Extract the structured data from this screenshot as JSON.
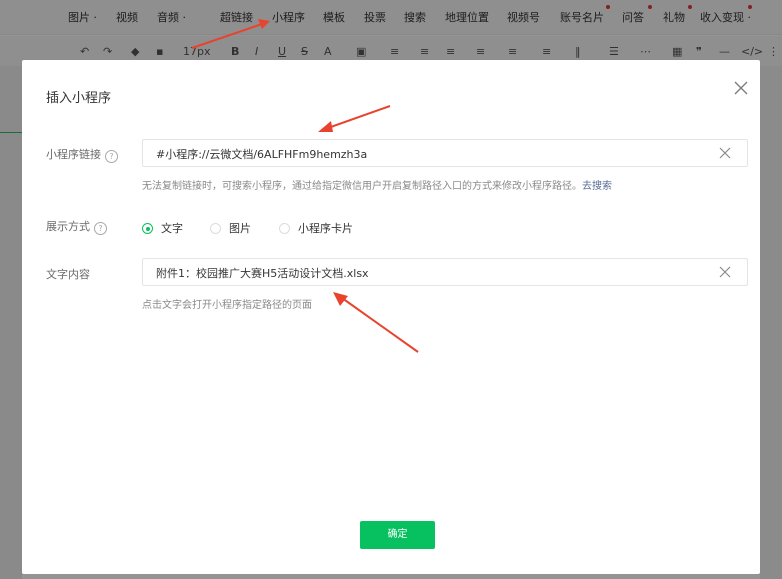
{
  "topbar": {
    "items": [
      {
        "label": "图片 ·"
      },
      {
        "label": "视频"
      },
      {
        "label": "音频 ·"
      },
      {
        "label": "超链接"
      },
      {
        "label": "小程序"
      },
      {
        "label": "模板"
      },
      {
        "label": "投票"
      },
      {
        "label": "搜索"
      },
      {
        "label": "地理位置"
      },
      {
        "label": "视频号"
      },
      {
        "label": "账号名片"
      },
      {
        "label": "问答"
      },
      {
        "label": "礼物"
      },
      {
        "label": "收入变现 ·"
      }
    ]
  },
  "toolbar": {
    "font_size": "17px",
    "bold": "B",
    "italic": "I",
    "underline": "U",
    "strike": "S",
    "font_color": "A",
    "quote": "❞",
    "divider": "—",
    "code": "</>"
  },
  "dialog": {
    "title": "插入小程序",
    "link_label": "小程序链接",
    "link_value": "#小程序://云微文档/6ALFHFm9hemzh3a",
    "link_hint": "无法复制链接时，可搜索小程序，通过给指定微信用户开启复制路径入口的方式来修改小程序路径。",
    "link_hint_action": "去搜索",
    "display_label": "展示方式",
    "display_options": [
      {
        "label": "文字",
        "selected": true
      },
      {
        "label": "图片",
        "selected": false
      },
      {
        "label": "小程序卡片",
        "selected": false
      }
    ],
    "text_label": "文字内容",
    "text_value": "附件1：校园推广大赛H5活动设计文档.xlsx",
    "text_hint": "点击文字会打开小程序指定路径的页面",
    "confirm_label": "确定"
  },
  "colors": {
    "accent": "#07c160",
    "annotation_arrow": "#e8432e",
    "link": "#576b95"
  }
}
